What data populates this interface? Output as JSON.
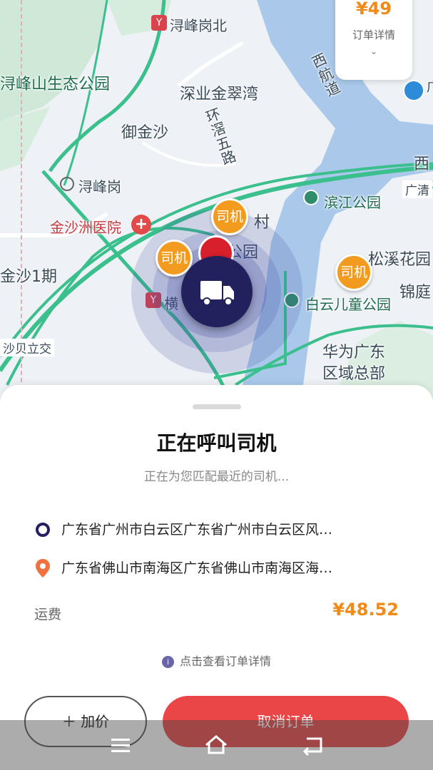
{
  "map": {
    "labels": {
      "xunfenggang_north": "浔峰岗北",
      "xunfeng_park": "浔峰山生态公园",
      "jincuiwan": "深业金翠湾",
      "yujinsha": "御金沙",
      "huanxi_road": "环\n滘\n五\n路",
      "xihang_road": "西\n航\n道",
      "xunfenggang": "浔峰岗",
      "jinshazhou_hospital": "金沙洲医院",
      "binjiang_park": "滨江公园",
      "guangqing": "广清",
      "xi": "西",
      "songxi": "松溪花园",
      "jinting": "锦庭",
      "jinsha_phase1": "金沙1期",
      "baiyun_children_park": "白云儿童公园",
      "huawei": "华为广东\n区域总部",
      "shabei": "沙贝立交",
      "cun": "村",
      "gongyuan": "公园",
      "heng": "横",
      "guang": "广"
    },
    "driver_badge": "司机",
    "metro_icon": "Y"
  },
  "price_card": {
    "price": "¥49",
    "label": "订单详情",
    "chevron": "⌄"
  },
  "sheet": {
    "title": "正在呼叫司机",
    "subtitle": "正在为您匹配最近的司机...",
    "origin": "广东省广州市白云区广东省广州市白云区风…",
    "destination": "广东省佛山市南海区广东省佛山市南海区海…",
    "fee_label": "运费",
    "fee_value": "¥48.52",
    "detail_link": "点击查看订单详情",
    "info_icon": "i",
    "raise_label": "＋ 加价",
    "cancel_label": "取消订单"
  },
  "colors": {
    "accent_orange": "#f08a19",
    "cancel_red": "#ea4547",
    "navy": "#23205e",
    "road_green": "#3bc08d",
    "river": "#a9c8ea"
  },
  "icons": [
    "truck-icon",
    "hospital-icon",
    "metro-icon",
    "park-icon",
    "location-pin-icon",
    "info-icon",
    "menu-icon",
    "home-icon",
    "back-icon"
  ]
}
